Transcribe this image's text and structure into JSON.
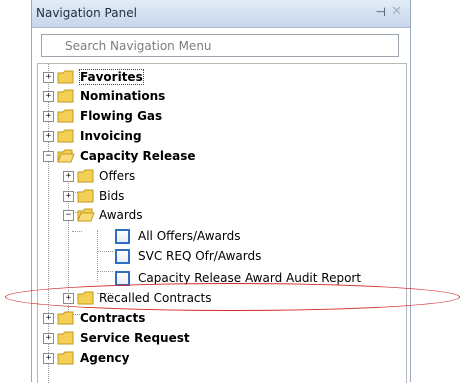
{
  "panel": {
    "title": "Navigation Panel",
    "pin_glyph": "⊣",
    "close_glyph": "✕",
    "search_placeholder": "Search Navigation Menu"
  },
  "tree": {
    "favorites": "Favorites",
    "nominations": "Nominations",
    "flowing_gas": "Flowing Gas",
    "invoicing": "Invoicing",
    "capacity_release": "Capacity Release",
    "offers": "Offers",
    "bids": "Bids",
    "awards": "Awards",
    "all_offers_awards": "All Offers/Awards",
    "svc_req": "SVC REQ Ofr/Awards",
    "audit_report": "Capacity Release Award Audit Report",
    "recalled_contracts": "Recalled Contracts",
    "contracts": "Contracts",
    "service_request": "Service Request",
    "agency": "Agency"
  },
  "colors": {
    "highlight_ellipse": "#d22a2a",
    "doc_icon_border": "#2e6fc4",
    "folder_yellow": "#f2c94c"
  }
}
